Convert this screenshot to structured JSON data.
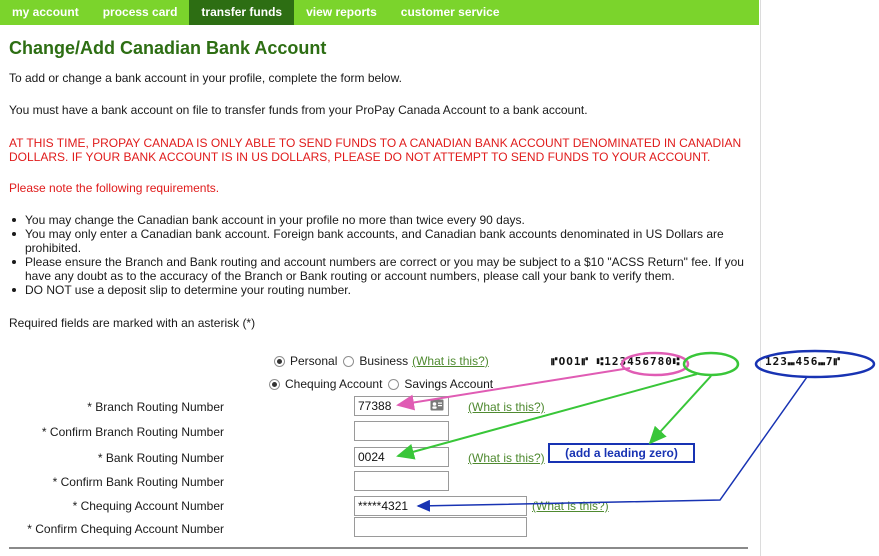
{
  "nav": {
    "tabs": [
      {
        "label": "my account"
      },
      {
        "label": "process card"
      },
      {
        "label": "transfer funds",
        "active": true
      },
      {
        "label": "view reports"
      },
      {
        "label": "customer service"
      }
    ]
  },
  "page": {
    "title": "Change/Add Canadian Bank Account",
    "intro1": "To add or change a bank account in your profile, complete the form below.",
    "intro2": "You must have a bank account on file to transfer funds from your ProPay Canada Account to a bank account.",
    "warning": "AT THIS TIME, PROPAY CANADA IS ONLY ABLE TO SEND FUNDS TO A CANADIAN BANK ACCOUNT DENOMINATED IN CANADIAN DOLLARS. IF YOUR BANK ACCOUNT IS IN US DOLLARS, PLEASE DO NOT ATTEMPT TO SEND FUNDS TO YOUR ACCOUNT.",
    "note": "Please note the following requirements.",
    "requirements": [
      "You may change the Canadian bank account in your profile no more than twice every 90 days.",
      "You may only enter a Canadian bank account. Foreign bank accounts, and Canadian bank accounts denominated in US Dollars are prohibited.",
      "Please ensure the Branch and Bank routing and account numbers are correct or you may be subject to a $10 \"ACSS Return\" fee. If you have any doubt as to the accuracy of the Branch or Bank routing or account numbers, please call your bank to verify them.",
      "DO NOT use a deposit slip to determine your routing number."
    ],
    "required_note": "Required fields are marked with an asterisk (*)"
  },
  "form": {
    "owner_type": {
      "personal": "Personal",
      "business": "Business",
      "selected": "personal",
      "what": "(What is this?)"
    },
    "account_type": {
      "chequing": "Chequing Account",
      "savings": "Savings Account",
      "selected": "chequing"
    },
    "branch_routing": {
      "label": "* Branch Routing Number",
      "value": "77388",
      "what": "(What is this?)"
    },
    "confirm_branch": {
      "label": "* Confirm Branch Routing Number",
      "value": ""
    },
    "bank_routing": {
      "label": "* Bank Routing Number",
      "value": "0024",
      "what": "(What is this?)"
    },
    "confirm_bank": {
      "label": "* Confirm Bank Routing Number",
      "value": ""
    },
    "chequing_number": {
      "label": "* Chequing Account Number",
      "value": "*****4321",
      "what": "(What is this?)"
    },
    "confirm_chequing": {
      "label": "* Confirm Chequing Account Number",
      "value": ""
    }
  },
  "annotations": {
    "leading_zero_note": "(add a leading zero)",
    "cheque_line_left": "⑈OO1⑈ ⑆123456780⑆",
    "cheque_line_right": "123⑉456⑉7⑈",
    "colors": {
      "pink": "#e05cb4",
      "green": "#39c639",
      "blue": "#1833b3"
    }
  },
  "colors": {
    "nav_bg": "#7bd42c",
    "nav_active": "#2d6e13",
    "title": "#2d6e13",
    "warning": "#e01b1b",
    "link": "#4f8a30"
  }
}
